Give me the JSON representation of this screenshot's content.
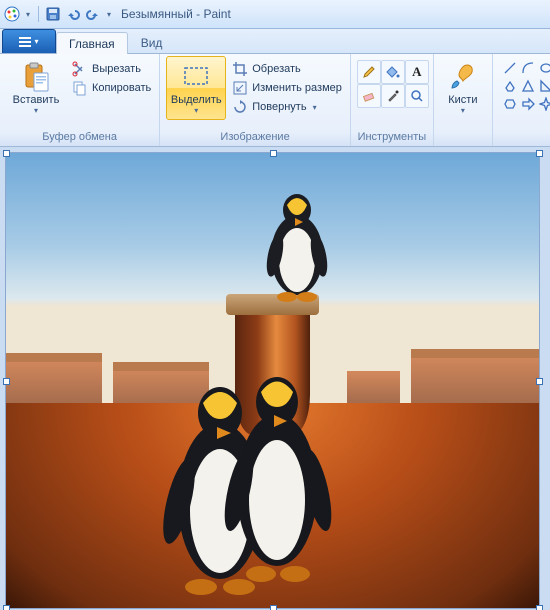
{
  "title": "Безымянный - Paint",
  "file_menu": {
    "caret": "▾"
  },
  "tabs": {
    "home": "Главная",
    "view": "Вид"
  },
  "clipboard": {
    "paste": "Вставить",
    "cut": "Вырезать",
    "copy": "Копировать",
    "group": "Буфер обмена"
  },
  "image": {
    "select": "Выделить",
    "crop": "Обрезать",
    "resize": "Изменить размер",
    "rotate": "Повернуть",
    "group": "Изображение"
  },
  "tools": {
    "group": "Инструменты"
  },
  "brushes": {
    "label": "Кисти"
  },
  "caret": "▾",
  "rotate_caret": "▾"
}
